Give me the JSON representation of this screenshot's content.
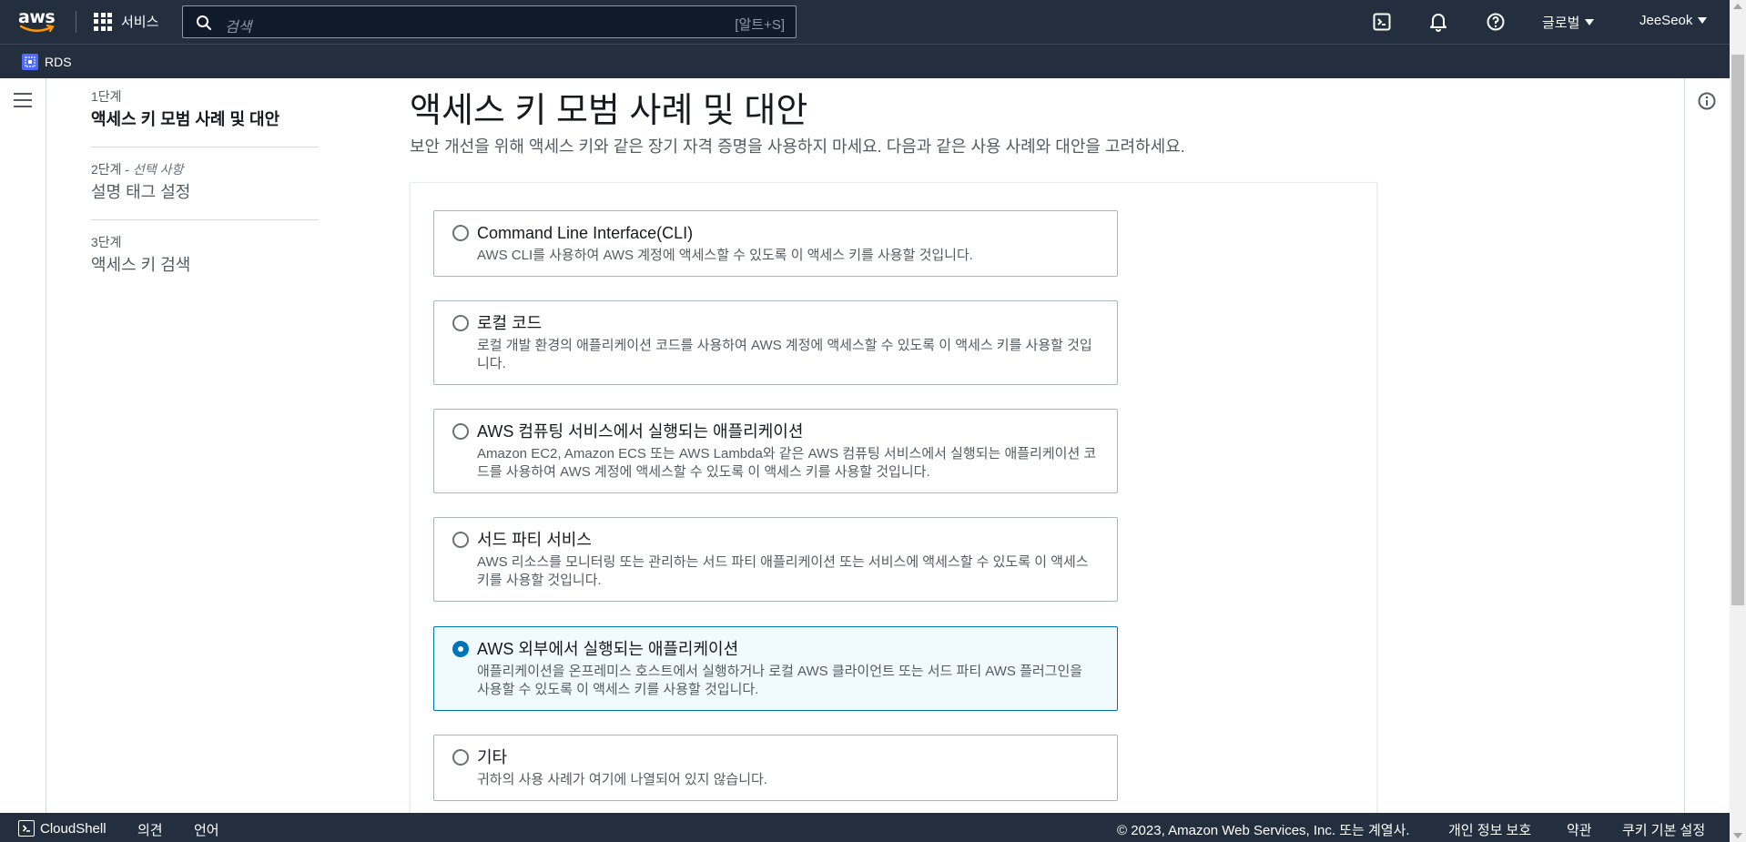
{
  "topbar": {
    "logo_text": "aws",
    "services_label": "서비스",
    "search_placeholder": "검색",
    "search_shortcut": "[알트+S]",
    "region_label": "글로벌",
    "user_label": "JeeSeok"
  },
  "subbar": {
    "service_label": "RDS"
  },
  "steps": [
    {
      "num": "1단계",
      "optional": "",
      "title": "액세스 키 모범 사례 및 대안"
    },
    {
      "num": "2단계 - ",
      "optional": "선택 사항",
      "title": "설명 태그 설정"
    },
    {
      "num": "3단계",
      "optional": "",
      "title": "액세스 키 검색"
    }
  ],
  "main": {
    "title": "액세스 키 모범 사례 및 대안",
    "description": "보안 개선을 위해 액세스 키와 같은 장기 자격 증명을 사용하지 마세요. 다음과 같은 사용 사례와 대안을 고려하세요."
  },
  "options": [
    {
      "title": "Command Line Interface(CLI)",
      "desc": "AWS CLI를 사용하여 AWS 계정에 액세스할 수 있도록 이 액세스 키를 사용할 것입니다.",
      "selected": false
    },
    {
      "title": "로컬 코드",
      "desc": "로컬 개발 환경의 애플리케이션 코드를 사용하여 AWS 계정에 액세스할 수 있도록 이 액세스 키를 사용할 것입니다.",
      "selected": false
    },
    {
      "title": "AWS 컴퓨팅 서비스에서 실행되는 애플리케이션",
      "desc": "Amazon EC2, Amazon ECS 또는 AWS Lambda와 같은 AWS 컴퓨팅 서비스에서 실행되는 애플리케이션 코드를 사용하여 AWS 계정에 액세스할 수 있도록 이 액세스 키를 사용할 것입니다.",
      "selected": false
    },
    {
      "title": "서드 파티 서비스",
      "desc": "AWS 리소스를 모니터링 또는 관리하는 서드 파티 애플리케이션 또는 서비스에 액세스할 수 있도록 이 액세스 키를 사용할 것입니다.",
      "selected": false
    },
    {
      "title": "AWS 외부에서 실행되는 애플리케이션",
      "desc": "애플리케이션을 온프레미스 호스트에서 실행하거나 로컬 AWS 클라이언트 또는 서드 파티 AWS 플러그인을 사용할 수 있도록 이 액세스 키를 사용할 것입니다.",
      "selected": true
    },
    {
      "title": "기타",
      "desc": "귀하의 사용 사례가 여기에 나열되어 있지 않습니다.",
      "selected": false
    }
  ],
  "footer": {
    "cloudshell": "CloudShell",
    "feedback": "의견",
    "language": "언어",
    "copyright": "© 2023, Amazon Web Services, Inc. 또는 계열사.",
    "privacy": "개인 정보 보호",
    "terms": "약관",
    "cookies": "쿠키 기본 설정"
  },
  "colors": {
    "nav_bg": "#232f3e",
    "accent": "#0073bb",
    "selected_bg": "#f1faff"
  }
}
